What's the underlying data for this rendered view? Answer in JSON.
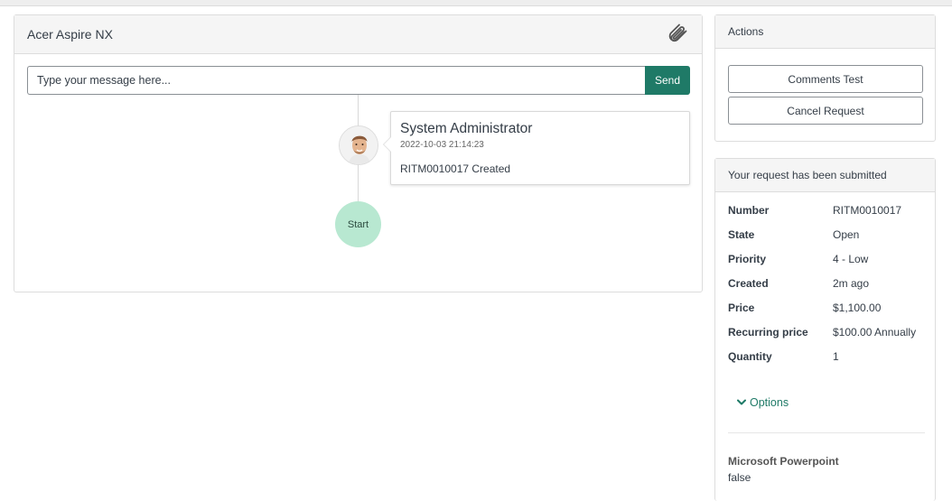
{
  "ticket": {
    "title": "Acer Aspire NX",
    "message_placeholder": "Type your message here...",
    "send_label": "Send"
  },
  "activity": {
    "author": "System Administrator",
    "timestamp": "2022-10-03 21:14:23",
    "text": "RITM0010017 Created",
    "start_label": "Start"
  },
  "actions": {
    "header": "Actions",
    "comments_test_label": "Comments Test",
    "cancel_request_label": "Cancel Request"
  },
  "summary": {
    "header": "Your request has been submitted",
    "fields": [
      {
        "label": "Number",
        "value": "RITM0010017"
      },
      {
        "label": "State",
        "value": "Open"
      },
      {
        "label": "Priority",
        "value": "4 - Low"
      },
      {
        "label": "Created",
        "value": "2m ago"
      },
      {
        "label": "Price",
        "value": "$1,100.00"
      },
      {
        "label": "Recurring price",
        "value": "$100.00 Annually"
      },
      {
        "label": "Quantity",
        "value": "1"
      }
    ],
    "options_label": "Options",
    "variables": [
      {
        "label": "Microsoft Powerpoint",
        "value": "false"
      }
    ]
  },
  "colors": {
    "accent": "#1f7a67",
    "start_node": "#b8e8d1"
  },
  "icons": {
    "attachment": "paperclip-icon",
    "options_toggle": "chevron-down-icon"
  }
}
